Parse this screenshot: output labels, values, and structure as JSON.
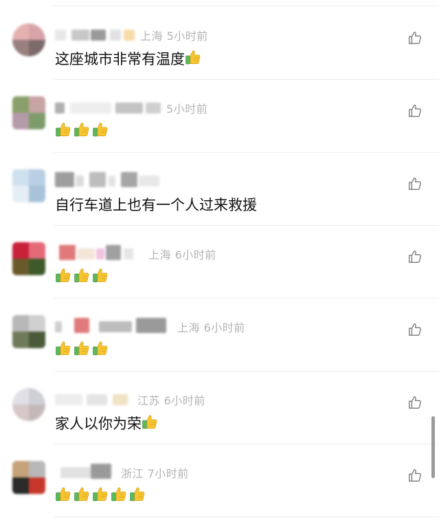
{
  "colors": {
    "meta_text": "#b4b4b4",
    "content_text": "#111111",
    "divider": "#ececec",
    "like_icon": "#7a7a7a"
  },
  "comments": [
    {
      "meta": "上海 5小时前",
      "content": "这座城市非常有温度",
      "emoji_count": 1,
      "avatar_colors": [
        "#e4b0b0",
        "#d9a4a8",
        "#9a7f7f",
        "#7d6a6a"
      ]
    },
    {
      "meta": "5小时前",
      "content": "",
      "emoji_count": 3,
      "avatar_colors": [
        "#8aa06a",
        "#c9a4a4",
        "#b59aa8",
        "#7e9c6a"
      ]
    },
    {
      "meta": "",
      "content": "自行车道上也有一个人过来救援",
      "emoji_count": 0,
      "avatar_colors": [
        "#cfe0ee",
        "#b9cfe3",
        "#e6eef5",
        "#a8c3d9"
      ]
    },
    {
      "meta": "上海 6小时前",
      "content": "",
      "emoji_count": 3,
      "avatar_colors": [
        "#c8213a",
        "#e46a7a",
        "#6a5a2a",
        "#3e5a2a"
      ]
    },
    {
      "meta": "上海 6小时前",
      "content": "",
      "emoji_count": 3,
      "avatar_colors": [
        "#b8b8b8",
        "#d0d0d0",
        "#6f7a5a",
        "#4a5a3a"
      ]
    },
    {
      "meta": "江苏 6小时前",
      "content": "家人以你为荣",
      "emoji_count": 1,
      "avatar_colors": [
        "#e0e0e6",
        "#cfcfd6",
        "#d7c8c8",
        "#c4b9b9"
      ]
    },
    {
      "meta": "浙江 7小时前",
      "content": "",
      "emoji_count": 5,
      "avatar_colors": [
        "#c6a27a",
        "#b8b8b8",
        "#2a2a2a",
        "#c7382a"
      ]
    }
  ]
}
